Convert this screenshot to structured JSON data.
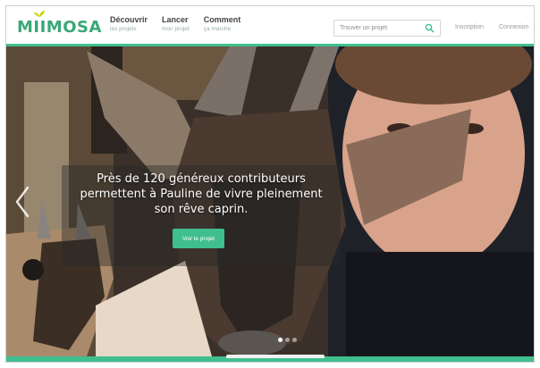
{
  "brand": {
    "name": "MIIMOSA",
    "accent_color": "#3fbf8e"
  },
  "nav": [
    {
      "title": "Découvrir",
      "sub": "les projets"
    },
    {
      "title": "Lancer",
      "sub": "mon projet"
    },
    {
      "title": "Comment",
      "sub": "ça marche"
    }
  ],
  "search": {
    "placeholder": "Trouver un projet",
    "icon": "search-icon"
  },
  "auth": {
    "signup": "Inscription",
    "login": "Connexion"
  },
  "hero": {
    "caption_lines": [
      "Près de 120 généreux contributeurs",
      "permettent à Pauline de vivre pleinement",
      "son rêve caprin."
    ],
    "cta_label": "Voir le projet",
    "prev_icon": "chevron-left-icon",
    "slides": {
      "count": 3,
      "active_index": 0
    }
  }
}
